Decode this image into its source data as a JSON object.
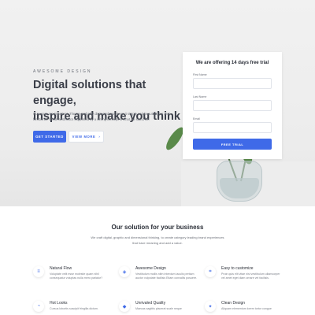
{
  "hero": {
    "eyebrow": "AWESOME DESIGN",
    "headline_line1": "Digital solutions that engage,",
    "headline_line2": "inspire and make you think",
    "subtext_line1": "Our users are impatient. They're probably distracted too. Keep it simple and beautiful, fun and",
    "subtext_line2": "functional. Clean aesthetics supported by a strong concept is what we stand for.",
    "primary_button": "GET STARTED",
    "secondary_button": "VIEW MORE",
    "secondary_button_icon": "›"
  },
  "trial_form": {
    "title": "We are offering 14 days free trial",
    "first_name_label": "First Name",
    "last_name_label": "Last Name",
    "email_label": "Email",
    "submit_label": "FREE TRIAL"
  },
  "solutions": {
    "title": "Our solution for your business",
    "desc_line1": "We craft digital, graphic and dimensional thinking, to create category leading brand experiences",
    "desc_line2": "that have meaning and add a value.",
    "features": [
      {
        "title": "Natural Flow",
        "icon": "list-icon",
        "glyph": "≡",
        "desc": "Voluptate velit esse molestie quam nihil consequatur voluptas nulla mero pariatur?"
      },
      {
        "title": "Awesome Design",
        "icon": "layers-icon",
        "glyph": "◈",
        "desc": "Vestibulum mollis nibh interdum iaculis pretium auctor vulputate facilisis Etiam convallis posuere."
      },
      {
        "title": "Easy to customize",
        "icon": "crop-icon",
        "glyph": "⌗",
        "desc": "Proin quis elit vitae nisi vestibulum ullamcorper vel amet eget diam ornare vel facilisis."
      },
      {
        "title": "Hot Looks",
        "icon": "flame-icon",
        "glyph": "◔",
        "desc": "Cursus lobortis suscipit fringilla dictum."
      },
      {
        "title": "Unrivaled Quality",
        "icon": "shield-icon",
        "glyph": "◆",
        "desc": "Maecas sagittis placerat scale neque"
      },
      {
        "title": "Clean Design",
        "icon": "clean-icon",
        "glyph": "✦",
        "desc": "Aliquam elementum lorem tortor congue"
      }
    ]
  },
  "colors": {
    "accent": "#3f6ae8",
    "hero_bg": "#eeeeee",
    "text_dark": "#2b2f38"
  }
}
